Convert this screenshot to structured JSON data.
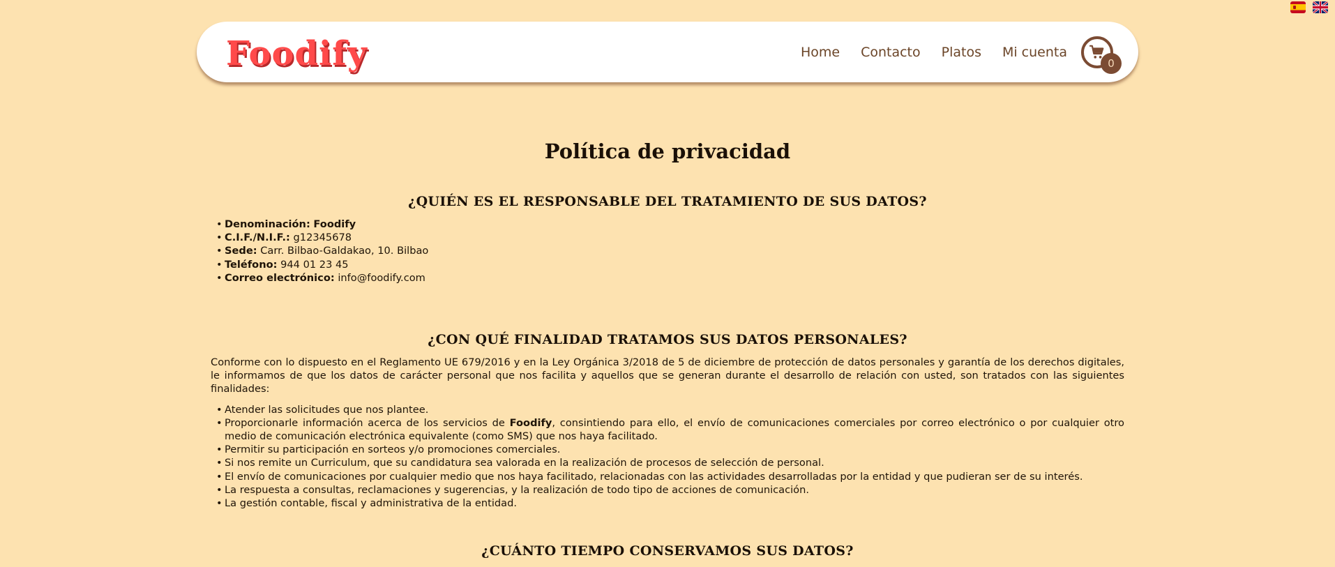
{
  "languages": [
    {
      "code": "es",
      "icon": "spain-flag-icon"
    },
    {
      "code": "en",
      "icon": "uk-flag-icon"
    }
  ],
  "header": {
    "logo": "Foodify",
    "nav": [
      "Home",
      "Contacto",
      "Platos",
      "Mi cuenta"
    ],
    "cart_count": "0",
    "cart_icon": "cart-icon"
  },
  "page": {
    "title": "Política de privacidad",
    "section1": {
      "title": "¿QUIÉN ES EL RESPONSABLE DEL TRATAMIENTO DE SUS DATOS?",
      "items": [
        {
          "label": "Denominación:",
          "value": "Foodify"
        },
        {
          "label": "C.I.F./N.I.F.:",
          "value": "g12345678"
        },
        {
          "label": "Sede:",
          "value": "Carr. Bilbao-Galdakao, 10. Bilbao"
        },
        {
          "label": "Teléfono:",
          "value": "944 01 23 45"
        },
        {
          "label": "Correo electrónico:",
          "value": "info@foodify.com"
        }
      ]
    },
    "section2": {
      "title": "¿CON QUÉ FINALIDAD TRATAMOS SUS DATOS PERSONALES?",
      "intro": "Conforme con lo dispuesto en el Reglamento UE 679/2016 y en la Ley Orgánica 3/2018 de 5 de diciembre de protección de datos personales y garantía de los derechos digitales, le informamos de que los datos de carácter personal que nos facilita y aquellos que se generan durante el desarrollo de relación con usted, son tratados con las siguientes finalidades:",
      "item1": "Atender las solicitudes que nos plantee.",
      "item2_pre": "Proporcionarle información acerca de los servicios de ",
      "item2_brand": "Foodify",
      "item2_post": ", consintiendo para ello, el envío de comunicaciones comerciales por correo electrónico o por cualquier otro medio de comunicación electrónica equivalente (como SMS) que nos haya facilitado.",
      "item3": "Permitir su participación en sorteos y/o promociones comerciales.",
      "item4": "Si nos remite un Curriculum, que su candidatura sea valorada en la realización de procesos de selección de personal.",
      "item5": "El envío de comunicaciones por cualquier medio que nos haya facilitado, relacionadas con las actividades desarrolladas por la entidad y que pudieran ser de su interés.",
      "item6": "La respuesta a consultas, reclamaciones y sugerencias, y la realización de todo tipo de acciones de comunicación.",
      "item7": "La gestión contable, fiscal y administrativa de la entidad."
    },
    "section3": {
      "title": "¿CUÁNTO TIEMPO CONSERVAMOS SUS DATOS?"
    }
  },
  "colors": {
    "background": "#fde2b0",
    "logo": "#ff4a4a",
    "nav_text": "#6b4528",
    "cart": "#7b4b33"
  }
}
